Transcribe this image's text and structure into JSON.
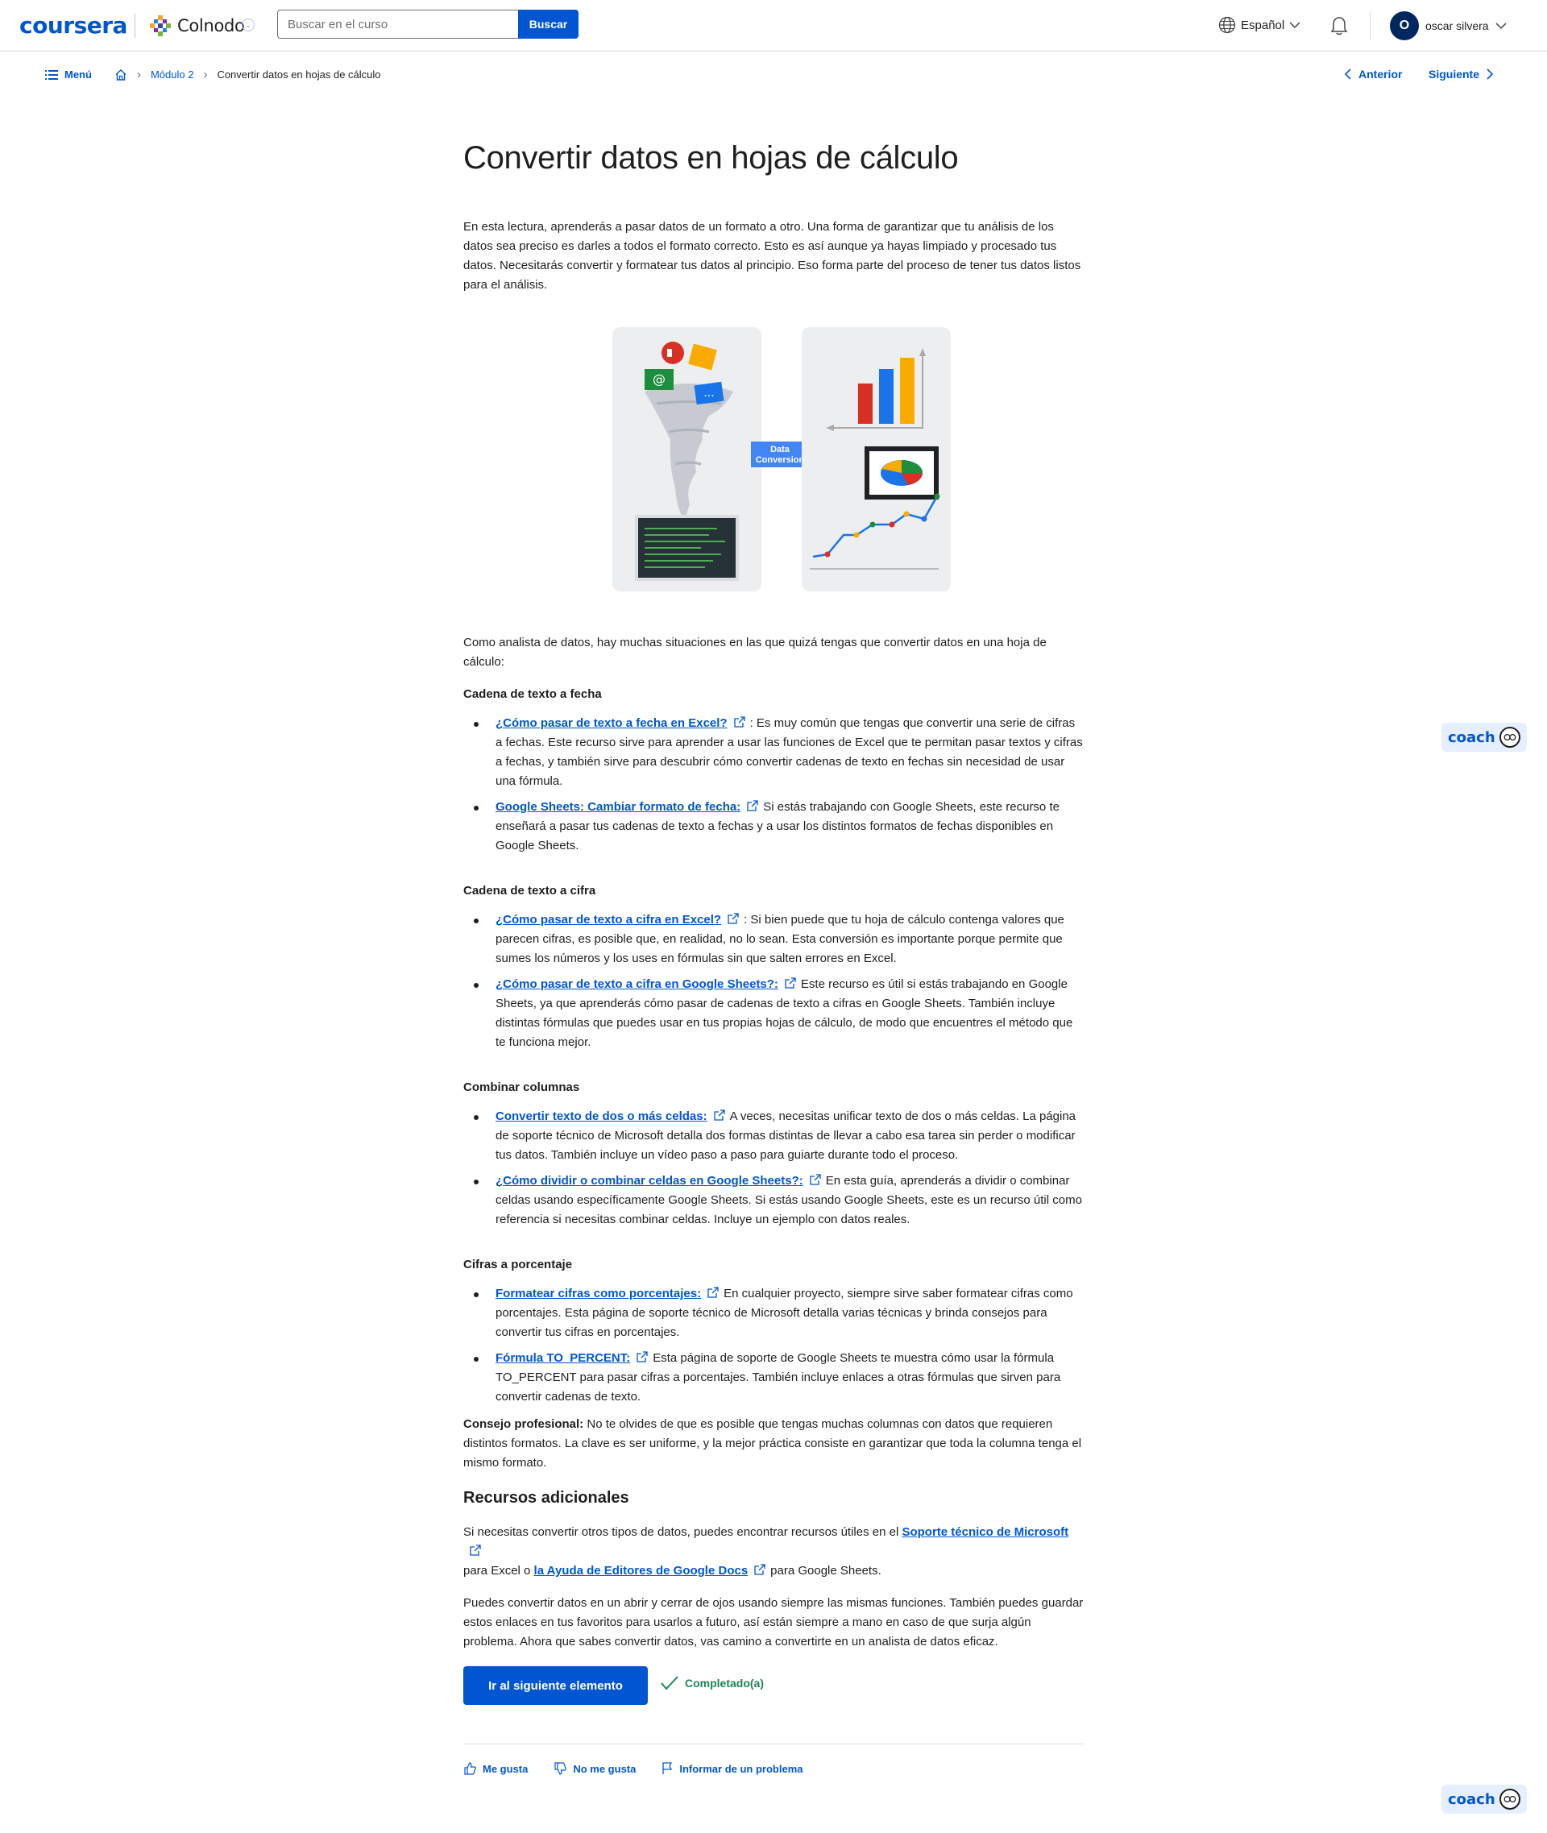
{
  "header": {
    "logo": "coursera",
    "partner": "Colnodo",
    "search_placeholder": "Buscar en el curso",
    "search_button": "Buscar",
    "language": "Español",
    "user_initial": "O",
    "user_name": "oscar silvera"
  },
  "breadcrumb": {
    "menu": "Menú",
    "module": "Módulo 2",
    "current": "Convertir datos en hojas de cálculo"
  },
  "pager": {
    "previous": "Anterior",
    "next": "Siguiente"
  },
  "article": {
    "title": "Convertir datos en hojas de cálculo",
    "intro": "En esta lectura, aprenderás a pasar datos de un formato a otro. Una forma de garantizar que tu análisis de los datos sea preciso es darles a todos el formato correcto. Esto es así aunque ya hayas limpiado y procesado tus datos. Necesitarás convertir y formatear tus datos al principio. Eso forma parte del proceso de tener tus datos listos para el análisis.",
    "figure_label_1": "Data",
    "figure_label_2": "Conversion",
    "lead": "Como analista de datos, hay muchas situaciones en las que quizá tengas que convertir datos en una hoja de cálculo:",
    "sections": [
      {
        "heading": "Cadena de texto a fecha",
        "items": [
          {
            "link": "¿Cómo pasar de texto a fecha en Excel?",
            "text": ": Es muy común que tengas que convertir una serie de cifras a fechas. Este recurso sirve para aprender a usar las funciones de Excel que te permitan pasar textos y cifras a fechas, y también sirve para descubrir cómo convertir cadenas de texto en fechas sin necesidad de usar una fórmula."
          },
          {
            "link": "Google Sheets: Cambiar formato de fecha:",
            "text": "Si estás trabajando con Google Sheets, este recurso te enseñará a pasar tus cadenas de texto a fechas y a usar los distintos formatos de fechas disponibles en Google Sheets."
          }
        ]
      },
      {
        "heading": "Cadena de texto a cifra",
        "items": [
          {
            "link": "¿Cómo pasar de texto a cifra en Excel?",
            "text": ": Si bien puede que tu hoja de cálculo contenga valores que parecen cifras, es posible que, en realidad, no lo sean. Esta conversión es importante porque permite que sumes los números y los uses en fórmulas sin que salten errores en Excel."
          },
          {
            "link": "¿Cómo pasar de texto a cifra en Google Sheets?:",
            "text": "Este recurso es útil si estás trabajando en Google Sheets, ya que aprenderás cómo pasar de cadenas de texto a cifras en Google Sheets. También incluye distintas fórmulas que puedes usar en tus propias hojas de cálculo, de modo que encuentres el método que te funciona mejor."
          }
        ]
      },
      {
        "heading": "Combinar columnas",
        "items": [
          {
            "link": "Convertir texto de dos o más celdas:",
            "text": "A veces, necesitas unificar texto de dos o más celdas. La página de soporte técnico de Microsoft detalla dos formas distintas de llevar a cabo esa tarea sin perder o modificar tus datos. También incluye un vídeo paso a paso para guiarte durante todo el proceso."
          },
          {
            "link": "¿Cómo dividir o combinar celdas en Google Sheets?:",
            "text": "En esta guía, aprenderás a dividir o combinar celdas usando específicamente Google Sheets. Si estás usando Google Sheets, este es un recurso útil como referencia si necesitas combinar celdas. Incluye un ejemplo con datos reales."
          }
        ]
      },
      {
        "heading": "Cifras a porcentaje",
        "items": [
          {
            "link": "Formatear cifras como porcentajes:",
            "text": "En cualquier proyecto, siempre sirve saber formatear cifras como porcentajes. Esta página de soporte técnico de Microsoft detalla varias técnicas y brinda consejos para convertir tus cifras en porcentajes."
          },
          {
            "link": "Fórmula TO_PERCENT:",
            "text": "Esta página de soporte de Google Sheets te muestra cómo usar la fórmula TO_PERCENT para pasar cifras a porcentajes. También incluye enlaces a otras fórmulas que sirven para convertir cadenas de texto."
          }
        ]
      }
    ],
    "tip_label": "Consejo profesional:",
    "tip_text": " No te olvides de que es posible que tengas muchas columnas con datos que requieren distintos formatos. La clave es ser uniforme, y la mejor práctica consiste en garantizar que toda la columna tenga el mismo formato.",
    "additional_heading": "Recursos adicionales",
    "additional_p1_a": "Si necesitas convertir otros tipos de datos, puedes encontrar recursos útiles en el ",
    "additional_link_1": "Soporte técnico de Microsoft",
    "additional_p1_b": "para Excel o ",
    "additional_link_2": "la Ayuda de Editores de Google Docs",
    "additional_p1_c": "para Google Sheets.",
    "additional_p2": "Puedes convertir datos en un abrir y cerrar de ojos usando siempre las mismas funciones. También puedes guardar estos enlaces en tus favoritos para usarlos a futuro, así están siempre a mano en caso de que surja algún problema. Ahora que sabes convertir datos, vas camino a convertirte en un analista de datos eficaz."
  },
  "actions": {
    "next_item": "Ir al siguiente elemento",
    "completed": "Completado(a)"
  },
  "feedback": {
    "like": "Me gusta",
    "dislike": "No me gusta",
    "report": "Informar de un problema"
  },
  "coach": {
    "label": "coach"
  },
  "colors": {
    "brand": "#0056d2",
    "completed": "#1f8354"
  }
}
